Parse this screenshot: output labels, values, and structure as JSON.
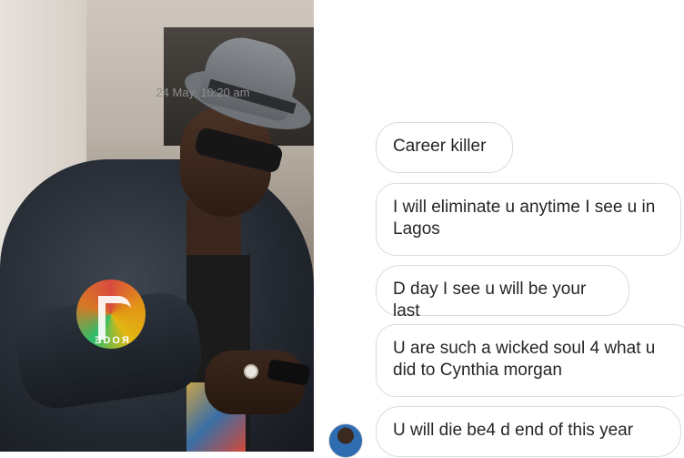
{
  "photo": {
    "watermark_text": "ƎDOЯ"
  },
  "chat": {
    "timestamp": "24 May, 10:20 am",
    "messages": [
      "Career killer",
      "I will eliminate u anytime I see u in Lagos",
      "D day I see u will be your last",
      "U are such a wicked soul 4 what u did to Cynthia morgan",
      "U will die be4 d end of this year"
    ]
  }
}
